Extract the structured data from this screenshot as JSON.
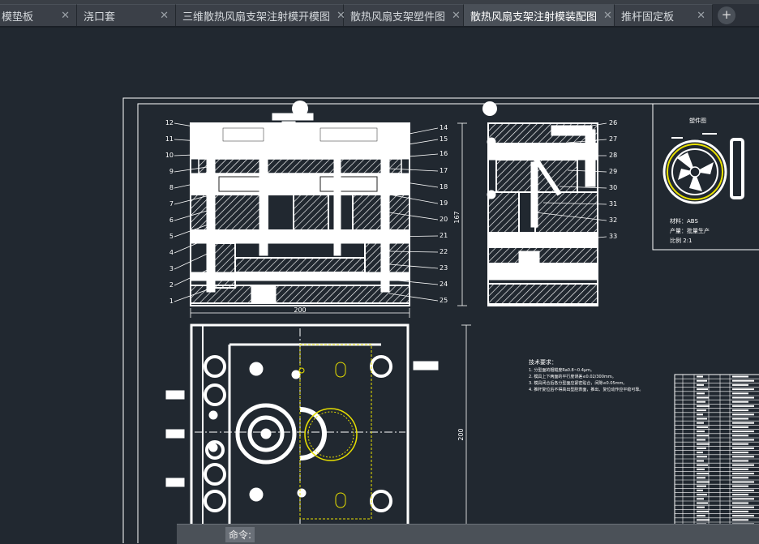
{
  "tabs": [
    {
      "label": "模垫板",
      "active": false
    },
    {
      "label": "浇口套",
      "active": false
    },
    {
      "label": "三维散热风扇支架注射模开模图",
      "active": false
    },
    {
      "label": "散热风扇支架塑件图",
      "active": false
    },
    {
      "label": "散热风扇支架注射模装配图",
      "active": true
    },
    {
      "label": "推杆固定板",
      "active": false
    }
  ],
  "drawing": {
    "left_callouts": [
      "12",
      "11",
      "10",
      "9",
      "8",
      "7",
      "6",
      "5",
      "4",
      "3",
      "2",
      "1"
    ],
    "mid_callouts": [
      "14",
      "15",
      "16",
      "17",
      "18",
      "19",
      "20",
      "21",
      "22",
      "23",
      "24",
      "25"
    ],
    "right_callouts": [
      "26",
      "27",
      "28",
      "29",
      "30",
      "31",
      "32",
      "33"
    ],
    "dim_width_top": "200",
    "dim_height_side": "167",
    "dim_height_plan": "200",
    "part_title": "塑件图",
    "material_line": "材料：ABS",
    "production_line": "产量：批量生产",
    "scale_line": "比例 2:1",
    "tech_title": "技术要求：",
    "tech_lines": [
      "1. 分型面的粗糙度Ra0.8~0.4μm。",
      "2. 模具上下两面的平行度误差≤0.02/300mm。",
      "3. 模具闭合后各分型面应紧密贴合，间隙≤0.05mm。",
      "4. 推杆复位后不得高出型腔表面，推出、复位动作应平稳可靠。"
    ]
  },
  "command": {
    "label": "命令:"
  },
  "colors": {
    "background": "#212830",
    "linework": "#ffffff",
    "highlight": "#e8e000",
    "tab_active": "#4a5058"
  }
}
